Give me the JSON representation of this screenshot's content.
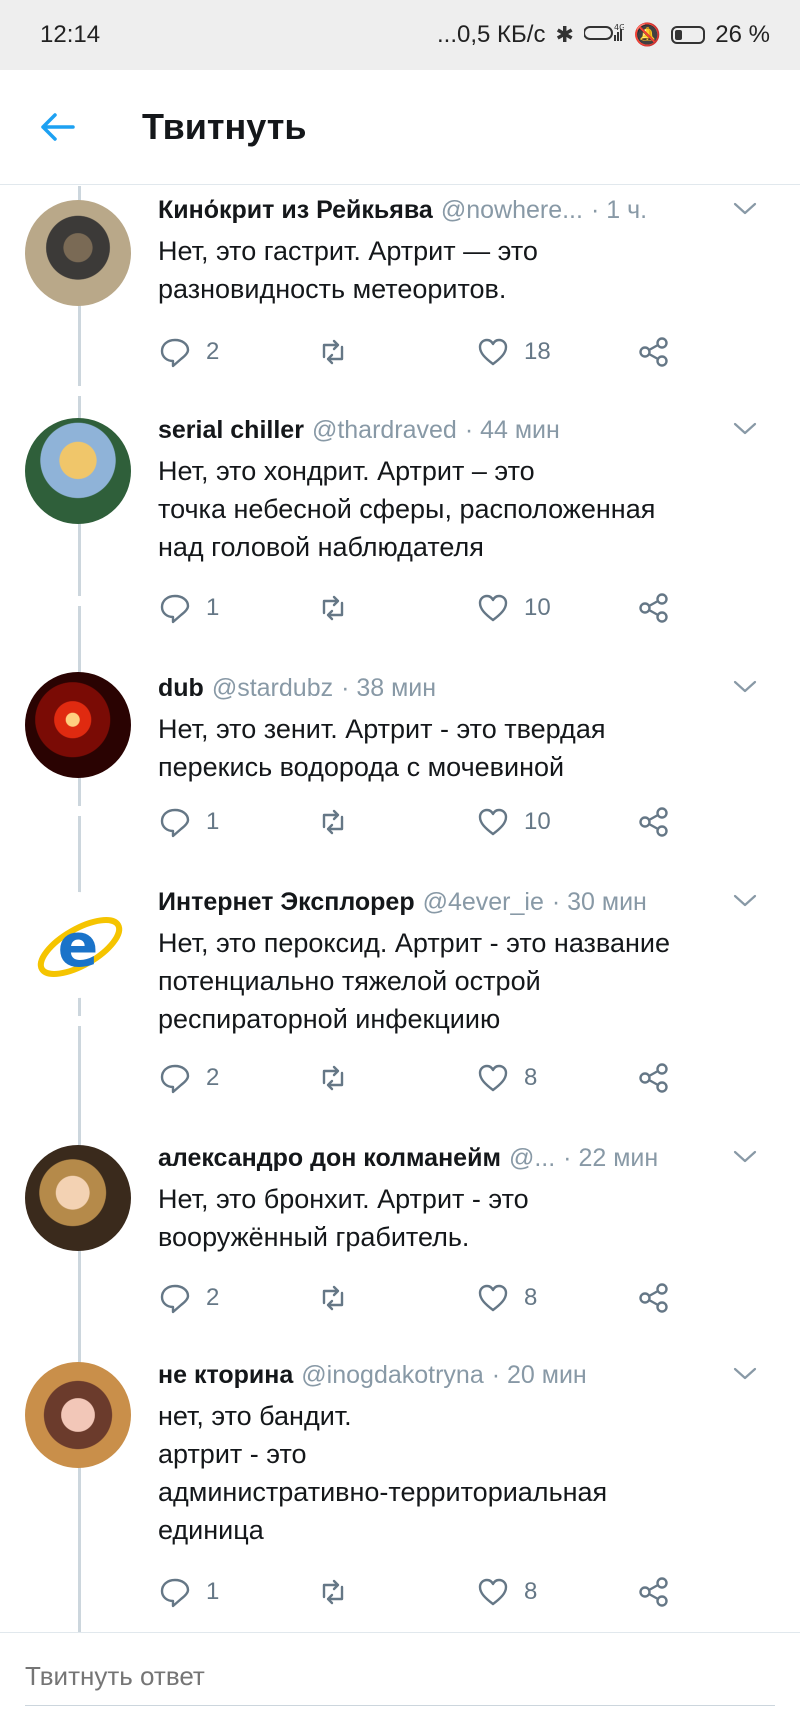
{
  "status_bar": {
    "time": "12:14",
    "network": "...0,5 КБ/с",
    "battery": "26 %",
    "signal": "4G"
  },
  "header": {
    "title": "Твитнуть",
    "back_icon": "arrow-left-icon"
  },
  "accent_color": "#1da1f2",
  "tweets": [
    {
      "author": "Кинόкрит из Рейкьява",
      "handle": "@nowhere...",
      "time": "· 1 ч.",
      "text": "Нет, это гастрит. Артрит — это\nразновидность метеоритов.",
      "replies": "2",
      "retweets": "",
      "likes": "18"
    },
    {
      "author": "serial chiller",
      "handle": "@thardraved",
      "time": "· 44 мин",
      "text": "Нет, это хондрит. Артрит – это\nточка небесной сферы, расположенная\nнад головой наблюдателя",
      "replies": "1",
      "retweets": "",
      "likes": "10"
    },
    {
      "author": "dub",
      "handle": "@stardubz",
      "time": "· 38 мин",
      "text": "Нет, это зенит. Артрит - это твердая\nперекись водорода с мочевиной",
      "replies": "1",
      "retweets": "",
      "likes": "10"
    },
    {
      "author": "Интернет Эксплорер",
      "handle": "@4ever_ie",
      "time": "· 30 мин",
      "text": "Нет, это пероксид. Артрит - это название\nпотенциально тяжелой острой\nреспираторной инфекциию",
      "replies": "2",
      "retweets": "",
      "likes": "8"
    },
    {
      "author": "александро дон колманейм",
      "handle": "@...",
      "time": "· 22 мин",
      "text": "Нет, это бронхит. Артрит - это\nвооружённый грабитель.",
      "replies": "2",
      "retweets": "",
      "likes": "8"
    },
    {
      "author": "не кторина",
      "handle": "@inogdakotryna",
      "time": "· 20 мин",
      "text": "нет, это бандит.\nартрит - это\nадминистративно-территориальная\nединица",
      "replies": "1",
      "retweets": "",
      "likes": "8"
    }
  ],
  "reply_bar": {
    "placeholder": "Твитнуть ответ"
  }
}
